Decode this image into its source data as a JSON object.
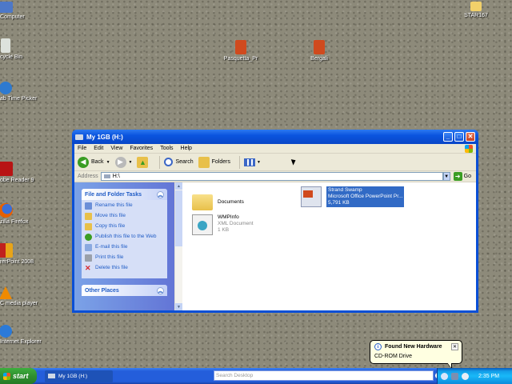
{
  "desktop": {
    "icons": [
      {
        "label": "Computer",
        "icon": "computer-icon",
        "color": "#4d78c8"
      },
      {
        "label": "cycle Bin",
        "icon": "recycle-bin-icon",
        "color": "#e2e6e0"
      },
      {
        "label": "Pasquetta_Pr",
        "icon": "powerpoint-icon",
        "color": "#d04a1e"
      },
      {
        "label": "Bergali",
        "icon": "powerpoint-icon",
        "color": "#d04a1e"
      },
      {
        "label": "STAR167",
        "icon": "folder-icon",
        "color": "#f1d06a"
      },
      {
        "label": "ab Time Picker",
        "icon": "clock-icon",
        "color": "#2e7ad0"
      },
      {
        "label": "obe Reader 9",
        "icon": "acrobat-icon",
        "color": "#b81414"
      },
      {
        "label": "zilla Firefox",
        "icon": "firefox-icon",
        "color": "#e66000"
      },
      {
        "label": "rerPoint 2008",
        "icon": "office-icon",
        "color": "#e8a418"
      },
      {
        "label": "C media player",
        "icon": "vlc-icon",
        "color": "#f08a00"
      },
      {
        "label": "Internet Explorer",
        "icon": "ie-icon",
        "color": "#2b7ad8"
      }
    ]
  },
  "window": {
    "title": "My 1GB (H:)",
    "menu": [
      "File",
      "Edit",
      "View",
      "Favorites",
      "Tools",
      "Help"
    ],
    "toolbar": {
      "back": "Back",
      "search": "Search",
      "folders": "Folders"
    },
    "address": {
      "label": "Address",
      "value": "H:\\",
      "go": "Go"
    },
    "taskpane": {
      "file_tasks": {
        "title": "File and Folder Tasks",
        "links": [
          {
            "label": "Rename this file",
            "icon": "rename-icon",
            "color": "#6b8fd8"
          },
          {
            "label": "Move this file",
            "icon": "move-icon",
            "color": "#e8c04a"
          },
          {
            "label": "Copy this file",
            "icon": "copy-icon",
            "color": "#e8c04a"
          },
          {
            "label": "Publish this file to the Web",
            "icon": "publish-icon",
            "color": "#3a9d23"
          },
          {
            "label": "E-mail this file",
            "icon": "email-icon",
            "color": "#8aa9e0"
          },
          {
            "label": "Print this file",
            "icon": "print-icon",
            "color": "#9aa0aa"
          },
          {
            "label": "Delete this file",
            "icon": "delete-icon",
            "color": "#d8282e"
          }
        ]
      },
      "other_places": {
        "title": "Other Places"
      }
    },
    "files": [
      {
        "name": "Documents",
        "type": "",
        "size": "",
        "icon": "folder-icon"
      },
      {
        "name": "Strand Swamp",
        "type": "Microsoft Office PowerPoint Pr...",
        "size": "5,791 KB",
        "icon": "powerpoint-file-icon"
      },
      {
        "name": "WMPInfo",
        "type": "XML Document",
        "size": "1 KB",
        "icon": "xml-file-icon"
      }
    ]
  },
  "balloon": {
    "title": "Found New Hardware",
    "text": "CD-ROM Drive"
  },
  "taskbar": {
    "start": "start",
    "task_button": "My 1GB (H:)",
    "search_placeholder": "Search Desktop",
    "time": "2:35 PM"
  }
}
